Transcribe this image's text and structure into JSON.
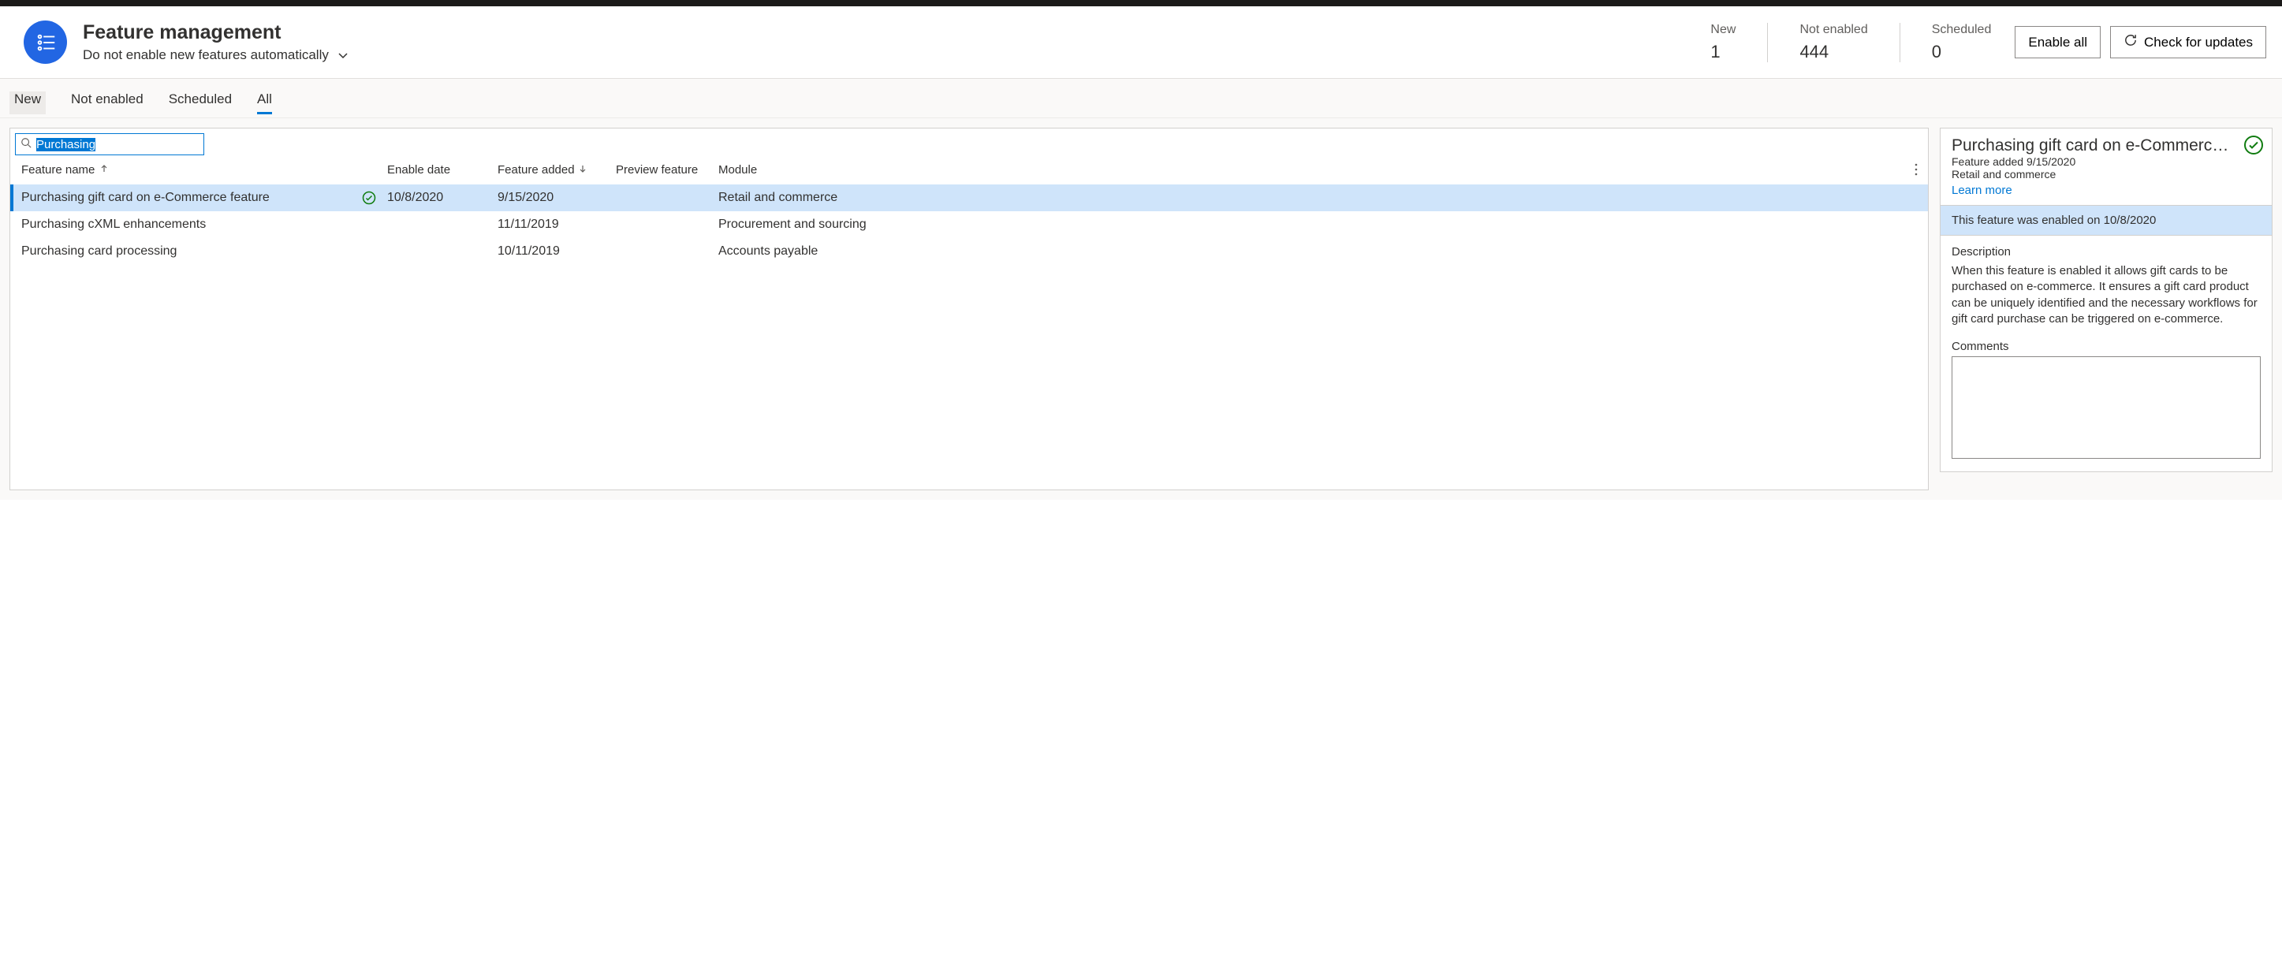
{
  "header": {
    "title": "Feature management",
    "subtitle": "Do not enable new features automatically"
  },
  "stats": {
    "new_label": "New",
    "new_value": "1",
    "not_enabled_label": "Not enabled",
    "not_enabled_value": "444",
    "scheduled_label": "Scheduled",
    "scheduled_value": "0"
  },
  "buttons": {
    "enable_all": "Enable all",
    "check_updates": "Check for updates"
  },
  "tabs": {
    "new": "New",
    "not_enabled": "Not enabled",
    "scheduled": "Scheduled",
    "all": "All"
  },
  "search": {
    "value": "Purchasing"
  },
  "columns": {
    "name": "Feature name",
    "enable": "Enable date",
    "added": "Feature added",
    "preview": "Preview feature",
    "module": "Module"
  },
  "rows": [
    {
      "name": "Purchasing gift card on e-Commerce feature",
      "enabled": true,
      "enable_date": "10/8/2020",
      "added": "9/15/2020",
      "preview": "",
      "module": "Retail and commerce"
    },
    {
      "name": "Purchasing cXML enhancements",
      "enabled": false,
      "enable_date": "",
      "added": "11/11/2019",
      "preview": "",
      "module": "Procurement and sourcing"
    },
    {
      "name": "Purchasing card processing",
      "enabled": false,
      "enable_date": "",
      "added": "10/11/2019",
      "preview": "",
      "module": "Accounts payable"
    }
  ],
  "detail": {
    "title": "Purchasing gift card on e-Commerce f...",
    "added_line": "Feature added 9/15/2020",
    "module": "Retail and commerce",
    "learn": "Learn more",
    "banner": "This feature was enabled on 10/8/2020",
    "desc_label": "Description",
    "description": "When this feature is enabled it allows gift cards to be purchased on e-commerce. It ensures a gift card product can be uniquely identified and the necessary workflows for gift card purchase can be triggered on e-commerce.",
    "comments_label": "Comments",
    "comments_value": ""
  }
}
